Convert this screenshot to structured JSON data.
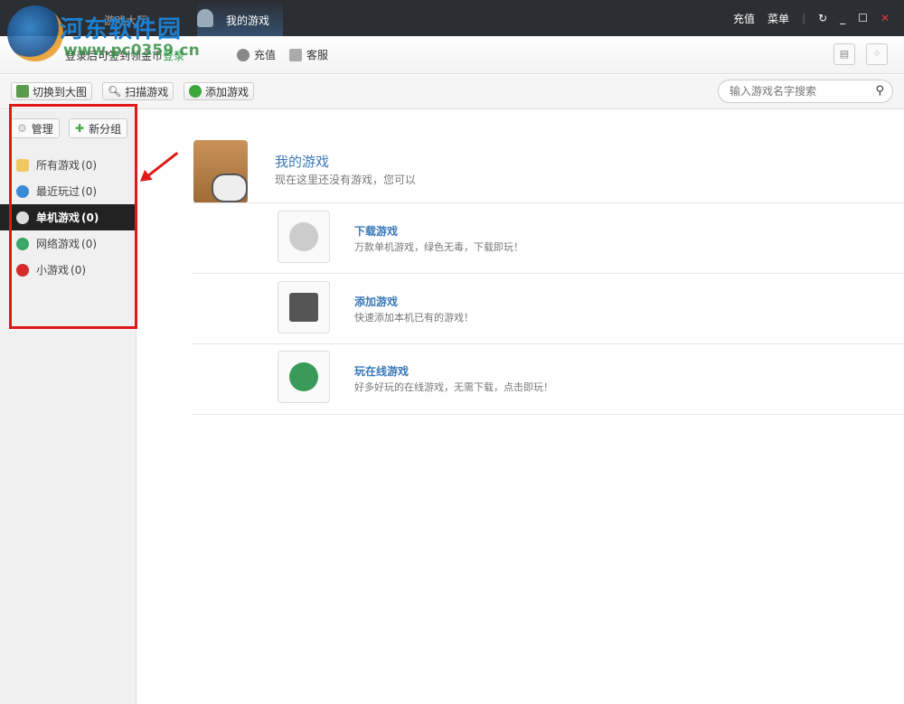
{
  "watermark": {
    "text": "河东软件园",
    "url": "www.pc0359.cn"
  },
  "titlebar": {
    "tabs": [
      {
        "label": "游戏大厅"
      },
      {
        "label": "我的游戏",
        "active": true
      }
    ],
    "recharge": "充值",
    "menu": "菜单"
  },
  "subbar": {
    "login_text": "登录后可签到领金币",
    "login_link": "登录",
    "recharge": "充值",
    "service": "客服"
  },
  "toolbar": {
    "switch_label": "切换到大图",
    "scan_label": "扫描游戏",
    "add_label": "添加游戏",
    "search_placeholder": "输入游戏名字搜索"
  },
  "sidebar": {
    "manage": "管理",
    "new_group": "新分组",
    "items": [
      {
        "label": "所有游戏",
        "count": "(0)",
        "icon": "folder-icon"
      },
      {
        "label": "最近玩过",
        "count": "(0)",
        "icon": "clock-icon"
      },
      {
        "label": "单机游戏",
        "count": "(0)",
        "icon": "mouse-icon",
        "active": true
      },
      {
        "label": "网络游戏",
        "count": "(0)",
        "icon": "globe-icon"
      },
      {
        "label": "小游戏",
        "count": "(0)",
        "icon": "joystick-icon"
      }
    ]
  },
  "main": {
    "title": "我的游戏",
    "subtitle": "现在这里还没有游戏，您可以",
    "actions": [
      {
        "title": "下载游戏",
        "desc": "万款单机游戏，绿色无毒，下载即玩！"
      },
      {
        "title": "添加游戏",
        "desc": "快速添加本机已有的游戏！"
      },
      {
        "title": "玩在线游戏",
        "desc": "好多好玩的在线游戏，无需下载，点击即玩！"
      }
    ]
  },
  "colors": {
    "accent": "#3a78b8",
    "highlight": "#e01818",
    "titlebar": "#2b2e33"
  }
}
